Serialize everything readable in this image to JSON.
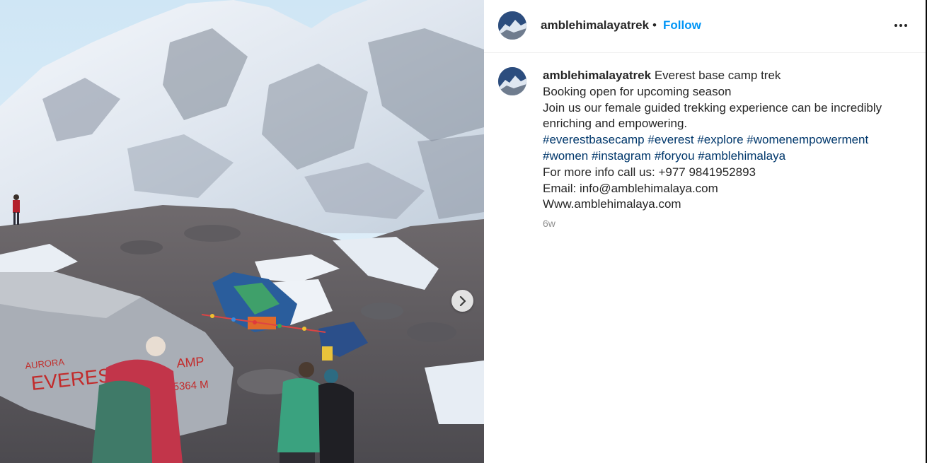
{
  "post": {
    "username": "amblehimalayatrek",
    "separator": "•",
    "follow_label": "Follow",
    "more_icon": "more-options-icon",
    "next_icon": "chevron-right-icon"
  },
  "caption": {
    "username": "amblehimalayatrek",
    "title": "Everest base camp trek",
    "lines": [
      "Booking open for upcoming season",
      "Join us our female guided trekking experience can be incredibly",
      "enriching and empowering."
    ],
    "hashtags_row1": [
      "#everestbasecamp",
      "#everest",
      "#explore",
      "#womenempowerment"
    ],
    "hashtags_row2": [
      "#women",
      "#instagram",
      "#foryou",
      "#amblehimalaya"
    ],
    "phone_line": "For more info call us: +977 9841952893",
    "email_line": "Email: info@amblehimalaya.com",
    "website_line": "Www.amblehimalaya.com",
    "time_ago": "6w"
  },
  "photo": {
    "rock_paint_text_1": "AURORA",
    "rock_paint_text_2": "EVERES",
    "rock_paint_text_3": "AMP",
    "rock_paint_text_4": "5364 M"
  },
  "colors": {
    "link": "#0095f6",
    "hashtag": "#00376b",
    "text": "#262626",
    "muted": "#8e8e8e"
  }
}
